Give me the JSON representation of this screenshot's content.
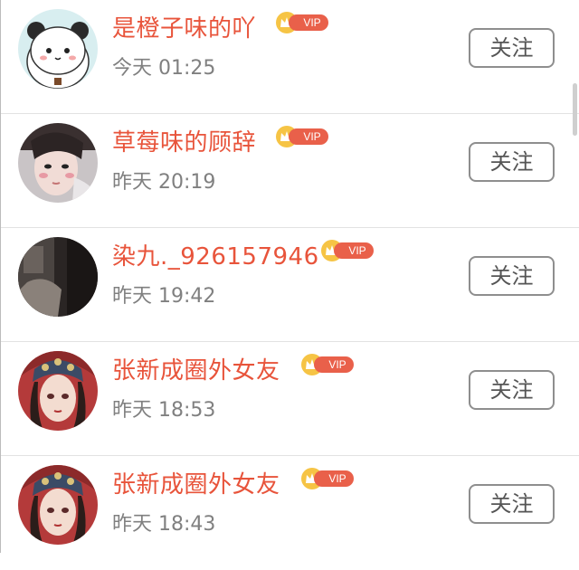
{
  "follow_list": {
    "items": [
      {
        "name": "是橙子味的吖",
        "time": "今天 01:25",
        "vip_label": "VIP",
        "button_label": "关注",
        "avatar": "panda-cartoon-avatar"
      },
      {
        "name": "草莓味的顾辞",
        "time": "昨天 20:19",
        "vip_label": "VIP",
        "button_label": "关注",
        "avatar": "girl-photo-avatar"
      },
      {
        "name": "染九._926157946",
        "time": "昨天 19:42",
        "vip_label": "VIP",
        "button_label": "关注",
        "avatar": "dark-photo-avatar"
      },
      {
        "name": "张新成圈外女友",
        "time": "昨天 18:53",
        "vip_label": "VIP",
        "button_label": "关注",
        "avatar": "illustrated-girl-avatar"
      },
      {
        "name": "张新成圈外女友",
        "time": "昨天 18:43",
        "vip_label": "VIP",
        "button_label": "关注",
        "avatar": "illustrated-girl-avatar"
      }
    ]
  },
  "colors": {
    "name": "#e8543b",
    "vip_pill": "#e9604a",
    "vip_crown": "#f6c445",
    "time": "#808080",
    "button_border": "#8e8e8e"
  }
}
